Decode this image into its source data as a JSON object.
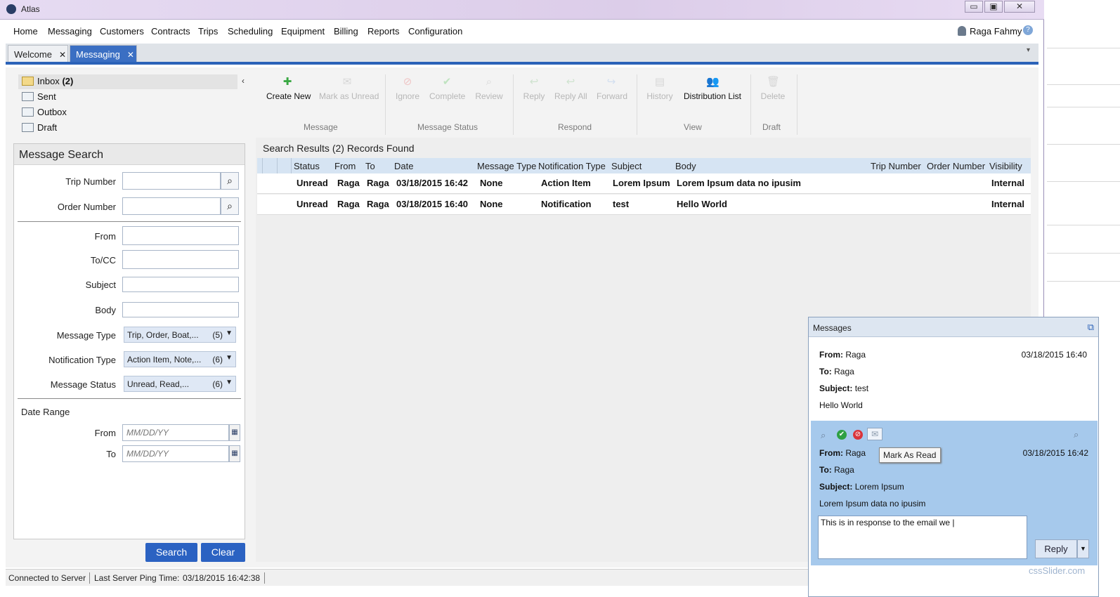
{
  "app": {
    "title": "Atlas",
    "window_controls": [
      "▭",
      "▣",
      "✕"
    ]
  },
  "menu": [
    "Home",
    "Messaging",
    "Customers",
    "Contracts",
    "Trips",
    "Scheduling",
    "Equipment",
    "Billing",
    "Reports",
    "Configuration"
  ],
  "user": {
    "name": "Raga Fahmy",
    "help": "?"
  },
  "tabs": [
    {
      "label": "Welcome",
      "close": "✕"
    },
    {
      "label": "Messaging",
      "close": "✕"
    }
  ],
  "tabstrip_menu": "▾",
  "folders": {
    "inbox": "Inbox",
    "inbox_count": "(2)",
    "sent": "Sent",
    "outbox": "Outbox",
    "draft": "Draft",
    "collapse": "‹"
  },
  "ribbon": {
    "create_new": "Create New",
    "mark_unread": "Mark as Unread",
    "ignore": "Ignore",
    "complete": "Complete",
    "review": "Review",
    "reply": "Reply",
    "reply_all": "Reply All",
    "forward": "Forward",
    "history": "History",
    "distribution_list": "Distribution List",
    "delete": "Delete",
    "groups": {
      "message": "Message",
      "message_status": "Message Status",
      "respond": "Respond",
      "view": "View",
      "draft": "Draft"
    }
  },
  "search": {
    "title": "Message Search",
    "trip_number": "Trip Number",
    "order_number": "Order Number",
    "from": "From",
    "to_cc": "To/CC",
    "subject": "Subject",
    "body": "Body",
    "message_type": "Message Type",
    "message_type_value": "Trip, Order, Boat,...",
    "message_type_count": "(5)",
    "notification_type": "Notification Type",
    "notification_type_value": "Action Item, Note,...",
    "notification_type_count": "(6)",
    "message_status": "Message Status",
    "message_status_value": "Unread, Read,...",
    "message_status_count": "(6)",
    "date_range": "Date Range",
    "date_from": "From",
    "date_to": "To",
    "date_placeholder": "MM/DD/YY",
    "search_btn": "Search",
    "clear_btn": "Clear"
  },
  "results": {
    "title": "Search Results (2) Records Found",
    "columns": [
      "Status",
      "From",
      "To",
      "Date",
      "Message Type",
      "Notification Type",
      "Subject",
      "Body",
      "Trip Number",
      "Order Number",
      "Visibility"
    ],
    "rows": [
      [
        "Unread",
        "Raga",
        "Raga",
        "03/18/2015 16:42",
        "None",
        "Action Item",
        "Lorem Ipsum",
        "Lorem Ipsum data no ipusim",
        "",
        "",
        "Internal"
      ],
      [
        "Unread",
        "Raga",
        "Raga",
        "03/18/2015 16:40",
        "None",
        "Notification",
        "test",
        "Hello World",
        "",
        "",
        "Internal"
      ]
    ]
  },
  "statusbar": {
    "connection": "Connected to Server",
    "ping_label": "Last Server Ping Time:",
    "ping_time": "03/18/2015 16:42:38"
  },
  "popup": {
    "title": "Messages",
    "from_label": "From:",
    "to_label": "To:",
    "subject_label": "Subject:",
    "msg1": {
      "from": "Raga",
      "to": "Raga",
      "subject": "test",
      "body": "Hello World",
      "date": "03/18/2015 16:40"
    },
    "msg2": {
      "from": "Raga",
      "to": "Raga",
      "subject": "Lorem Ipsum",
      "body": "Lorem Ipsum data no ipusim",
      "date": "03/18/2015 16:42"
    },
    "tooltip": "Mark As Read",
    "reply_text": "This is in response to the email we |",
    "reply_btn": "Reply"
  },
  "watermark": "cssSlider.com",
  "colors": {
    "accent": "#2b62b8",
    "tab_active": "#3b6fc3",
    "button": "#2b62c2",
    "highlight": "#a6c9ec"
  }
}
